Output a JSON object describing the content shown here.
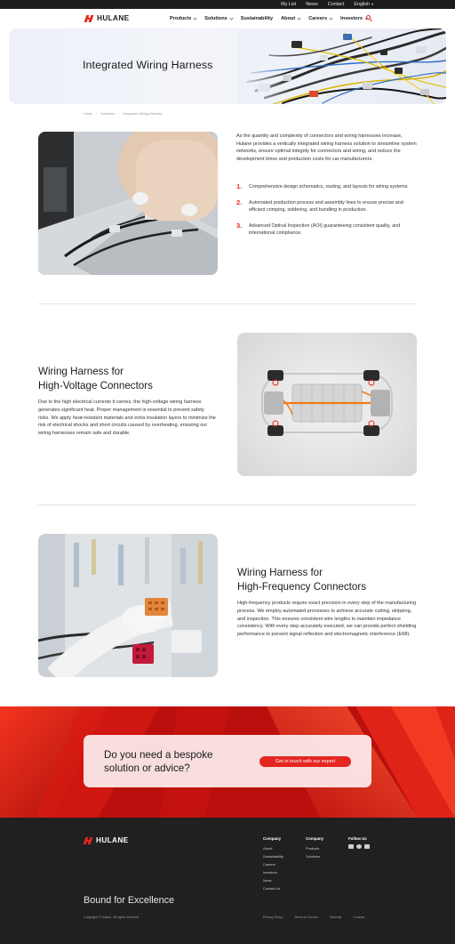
{
  "topbar": {
    "links": [
      "My List",
      "News",
      "Contact"
    ],
    "language": "English"
  },
  "brand": {
    "name": "HULANE",
    "color": "#e52620"
  },
  "nav": {
    "items": [
      {
        "label": "Products",
        "dropdown": true
      },
      {
        "label": "Solutions",
        "dropdown": true
      },
      {
        "label": "Sustainability",
        "dropdown": false
      },
      {
        "label": "About",
        "dropdown": true
      },
      {
        "label": "Careers",
        "dropdown": true
      },
      {
        "label": "Investors",
        "dropdown": true
      }
    ],
    "search_icon": "search-icon"
  },
  "hero": {
    "title": "Integrated Wiring Harness"
  },
  "breadcrumb": [
    "Home",
    "Solutions",
    "Integrated Wiring Harness"
  ],
  "intro": {
    "text": "As the quantity and complexity of connectors and wiring harnesses increase, Hulane provides a vertically integrated wiring harness solution to streamline system networks, ensure optimal integrity for connectors and wiring, and reduce the development times and production costs for car manufacturers.",
    "features": [
      {
        "num": "1.",
        "text": "Comprehensive design schematics, routing, and layouts for wiring systems."
      },
      {
        "num": "2.",
        "text": "Automated production process and assembly lines to ensure precise and efficient crimping, soldering, and bundling in production."
      },
      {
        "num": "3.",
        "text": "Advanced Optical Inspection (AOI) guaranteeing consistent quality, and international compliance."
      }
    ]
  },
  "section_hv": {
    "title_line1": "Wiring Harness for",
    "title_line2": "High-Voltage Connectors",
    "text": "Due to the high electrical currents it carries, the high-voltage wiring harness generates significant heat. Proper management is essential to prevent safety risks. We apply heat-resistant materials and extra insulation layers to minimize the risk of electrical shocks and short circuits caused by overheating, ensuring our wiring harnesses remain safe and durable."
  },
  "section_hf": {
    "title_line1": "Wiring Harness for",
    "title_line2": "High-Frequency Connectors",
    "text": "High-frequency products require exact precision in every step of the manufacturing process. We employ automated processes to achieve accurate cutting, stripping, and inspection. This ensures consistent wire lengths to maintain impedance consistency. With every step accurately executed, we can provide perfect shielding performance to prevent signal reflection and electromagnetic interference (EMI)."
  },
  "cta": {
    "question_line1": "Do you need a bespoke",
    "question_line2": "solution or advice?",
    "button": "Get in touch with our expert"
  },
  "footer": {
    "company1": {
      "heading": "Company",
      "links": [
        "About",
        "Sustainability",
        "Careers",
        "Investors",
        "News",
        "Contact Us"
      ]
    },
    "company2": {
      "heading": "Company",
      "links": [
        "Products",
        "Solutions"
      ]
    },
    "follow": {
      "heading": "Follow Us",
      "icons": [
        "linkedin-icon",
        "wechat-icon",
        "youtube-icon"
      ]
    },
    "tagline": "Bound for Excellence",
    "copyright": "Copyright © Hulane. All rights reserved.",
    "legal": [
      "Privacy Policy",
      "Terms of Service",
      "Sitemap",
      "Cookies"
    ]
  }
}
